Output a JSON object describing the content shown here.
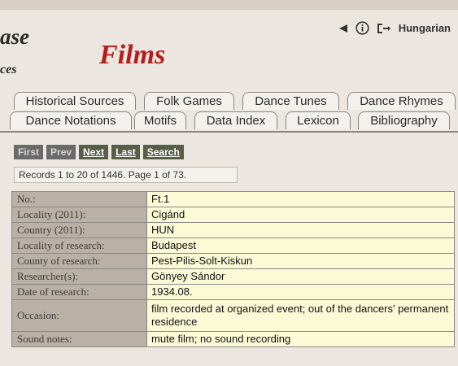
{
  "header": {
    "text_a": "ase",
    "text_b": "ces",
    "section_title": "Films",
    "language": "Hungarian",
    "icons": [
      "back-triangle-icon",
      "info-icon",
      "login-icon"
    ]
  },
  "tabs": {
    "row1": [
      "Historical Sources",
      "Folk Games",
      "Dance Tunes",
      "Dance Rhymes"
    ],
    "row2": [
      "Dance Notations",
      "Motifs",
      "Data Index",
      "Lexicon",
      "Bibliography"
    ]
  },
  "nav": {
    "first": "First",
    "prev": "Prev",
    "next": "Next",
    "last": "Last",
    "search": "Search"
  },
  "records_text": "Records 1 to 20 of 1446. Page 1 of 73.",
  "record": {
    "rows": [
      {
        "label": "No.:",
        "value": "Ft.1"
      },
      {
        "label": "Locality (2011):",
        "value": "Cigánd"
      },
      {
        "label": "Country (2011):",
        "value": "HUN"
      },
      {
        "label": "Locality of research:",
        "value": "Budapest"
      },
      {
        "label": "County of research:",
        "value": "Pest-Pilis-Solt-Kiskun"
      },
      {
        "label": "Researcher(s):",
        "value": "Gönyey Sándor"
      },
      {
        "label": "Date of research:",
        "value": "1934.08."
      },
      {
        "label": "Occasion:",
        "value": "film recorded at organized event; out of the dancers' permanent residence"
      },
      {
        "label": "Sound notes:",
        "value": "mute film; no sound recording"
      }
    ]
  },
  "colors": {
    "title_red": "#b71c1c",
    "label_bg": "#b9b1a6",
    "value_bg": "#fbfad6",
    "nav_active_bg": "#585f48",
    "nav_disabled_bg": "#6a6a6a"
  }
}
